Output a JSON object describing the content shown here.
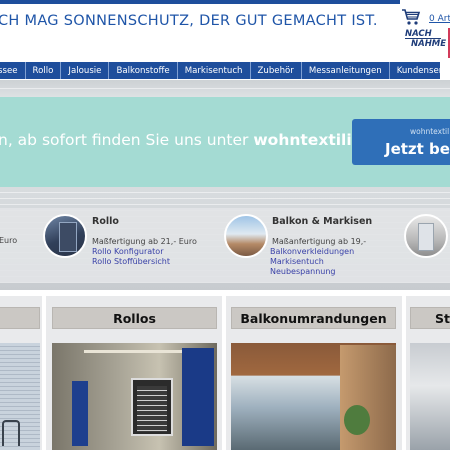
{
  "header": {
    "slogan": "CH MAG SONNENSCHUTZ, DER GUT GEMACHT IST.",
    "cart_count": "0 Arti",
    "cod_badge_line1": "NACH",
    "cod_badge_line2": "NAHME"
  },
  "nav": {
    "items": [
      "ssee",
      "Rollo",
      "Jalousie",
      "Balkonstoffe",
      "Markisentuch",
      "Zubehör",
      "Messanleitungen",
      "Kundenservice"
    ]
  },
  "banner": {
    "text_prefix": "n, ab sofort finden Sie uns unter ",
    "text_domain": "wohntextilien.de",
    "cta_small": "wohntextil",
    "cta_label": "Jetzt bes"
  },
  "categories": {
    "left_partial": "Euro",
    "rollo": {
      "title": "Rollo",
      "subtitle": "Maßfertigung ab 21,- Euro",
      "links": [
        "Rollo Konfigurator",
        "Rollo Stoffübersicht"
      ]
    },
    "balkon": {
      "title": "Balkon & Markisen",
      "subtitle": "Maßanfertigung ab 19,-",
      "links": [
        "Balkonverkleidungen",
        "Markisentuch",
        "Neubespannung"
      ]
    }
  },
  "sections": {
    "titles": [
      "",
      "Rollos",
      "Balkonumrandungen",
      "St"
    ]
  },
  "colors": {
    "brand_blue": "#1e4e9c",
    "banner_teal": "#a4dbd3",
    "cta_blue": "#2f6fb8",
    "link_color": "#3a42a8"
  }
}
